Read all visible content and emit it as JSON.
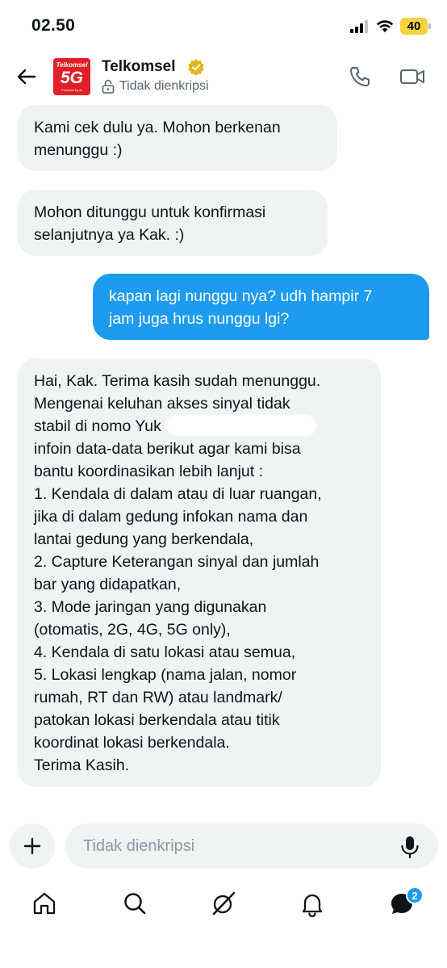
{
  "status_bar": {
    "time": "02.50",
    "battery": "40"
  },
  "header": {
    "contact_name": "Telkomsel",
    "encryption_status": "Tidak dienkripsi",
    "avatar": {
      "brand": "Telkomsel",
      "label": "5G",
      "sub": "Powered by AI"
    }
  },
  "messages": [
    {
      "direction": "incoming",
      "lines": [
        "Kami cek dulu ya. Mohon berkenan",
        "menunggu :)"
      ]
    },
    {
      "direction": "incoming",
      "lines": [
        "Mohon ditunggu untuk konfirmasi",
        "selanjutnya ya Kak. :)"
      ]
    },
    {
      "direction": "outgoing",
      "lines": [
        "kapan lagi nunggu nya? udh hampir 7",
        "jam juga hrus nunggu lgi?"
      ]
    },
    {
      "direction": "incoming",
      "lines": [
        "Hai, Kak. Terima kasih sudah menunggu.",
        "Mengenai keluhan akses sinyal tidak",
        "stabil di nomo                                    Yuk",
        "infoin data-data berikut agar kami bisa",
        "bantu koordinasikan lebih lanjut :",
        "1. Kendala di dalam atau di luar ruangan,",
        "jika di dalam gedung infokan nama dan",
        "lantai gedung yang berkendala,",
        "2. Capture Keterangan sinyal dan jumlah",
        "bar yang didapatkan,",
        "3. Mode jaringan yang digunakan",
        "(otomatis, 2G, 4G, 5G only),",
        "4. Kendala di satu lokasi atau semua,",
        "5. Lokasi lengkap (nama jalan, nomor",
        "rumah, RT dan RW) atau landmark/",
        "patokan lokasi berkendala atau titik",
        "koordinat lokasi berkendala.",
        "Terima Kasih."
      ]
    }
  ],
  "composer": {
    "placeholder": "Tidak dienkripsi"
  },
  "bottom_nav": {
    "items": [
      "home-icon",
      "search-icon",
      "grok-icon",
      "notifications-icon",
      "messages-icon"
    ],
    "messages_badge": "2"
  },
  "colors": {
    "accent": "#1d9bf0",
    "incoming_bubble": "#eff3f4",
    "brand_red": "#e11f26",
    "verified_gold": "#e2b719"
  }
}
